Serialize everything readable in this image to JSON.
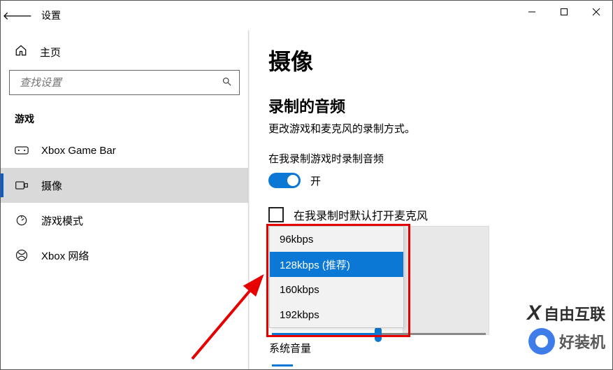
{
  "window_title": "设置",
  "titlebar": {
    "back_icon": "←"
  },
  "sidebar": {
    "home_label": "主页",
    "search_placeholder": "查找设置",
    "section_label": "游戏",
    "items": [
      {
        "label": "Xbox Game Bar"
      },
      {
        "label": "摄像"
      },
      {
        "label": "游戏模式"
      },
      {
        "label": "Xbox 网络"
      }
    ]
  },
  "main": {
    "title": "摄像",
    "audio_heading": "录制的音频",
    "audio_desc": "更改游戏和麦克风的录制方式。",
    "toggle_label": "在我录制游戏时录制音频",
    "toggle_state_label": "开",
    "checkbox_label": "在我录制时默认打开麦克风",
    "volume_label": "系统音量",
    "dropdown_options": [
      "96kbps",
      "128kbps (推荐)",
      "160kbps",
      "192kbps"
    ],
    "dropdown_selected_index": 1
  },
  "watermarks": {
    "wm1": "自由互联",
    "wm2": "好装机"
  }
}
